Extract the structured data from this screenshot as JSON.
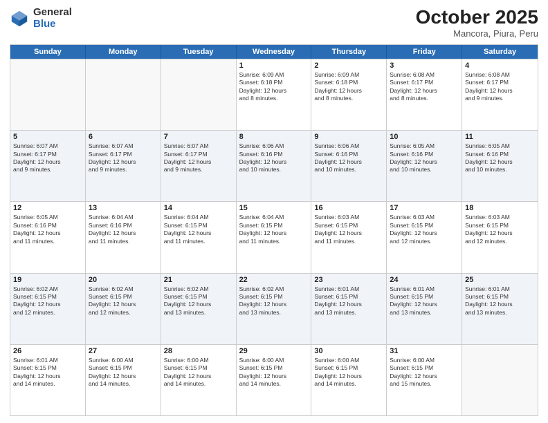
{
  "logo": {
    "general": "General",
    "blue": "Blue"
  },
  "header": {
    "month": "October 2025",
    "location": "Mancora, Piura, Peru"
  },
  "weekdays": [
    "Sunday",
    "Monday",
    "Tuesday",
    "Wednesday",
    "Thursday",
    "Friday",
    "Saturday"
  ],
  "rows": [
    {
      "alt": false,
      "cells": [
        {
          "day": "",
          "lines": []
        },
        {
          "day": "",
          "lines": []
        },
        {
          "day": "",
          "lines": []
        },
        {
          "day": "1",
          "lines": [
            "Sunrise: 6:09 AM",
            "Sunset: 6:18 PM",
            "Daylight: 12 hours",
            "and 8 minutes."
          ]
        },
        {
          "day": "2",
          "lines": [
            "Sunrise: 6:09 AM",
            "Sunset: 6:18 PM",
            "Daylight: 12 hours",
            "and 8 minutes."
          ]
        },
        {
          "day": "3",
          "lines": [
            "Sunrise: 6:08 AM",
            "Sunset: 6:17 PM",
            "Daylight: 12 hours",
            "and 8 minutes."
          ]
        },
        {
          "day": "4",
          "lines": [
            "Sunrise: 6:08 AM",
            "Sunset: 6:17 PM",
            "Daylight: 12 hours",
            "and 9 minutes."
          ]
        }
      ]
    },
    {
      "alt": true,
      "cells": [
        {
          "day": "5",
          "lines": [
            "Sunrise: 6:07 AM",
            "Sunset: 6:17 PM",
            "Daylight: 12 hours",
            "and 9 minutes."
          ]
        },
        {
          "day": "6",
          "lines": [
            "Sunrise: 6:07 AM",
            "Sunset: 6:17 PM",
            "Daylight: 12 hours",
            "and 9 minutes."
          ]
        },
        {
          "day": "7",
          "lines": [
            "Sunrise: 6:07 AM",
            "Sunset: 6:17 PM",
            "Daylight: 12 hours",
            "and 9 minutes."
          ]
        },
        {
          "day": "8",
          "lines": [
            "Sunrise: 6:06 AM",
            "Sunset: 6:16 PM",
            "Daylight: 12 hours",
            "and 10 minutes."
          ]
        },
        {
          "day": "9",
          "lines": [
            "Sunrise: 6:06 AM",
            "Sunset: 6:16 PM",
            "Daylight: 12 hours",
            "and 10 minutes."
          ]
        },
        {
          "day": "10",
          "lines": [
            "Sunrise: 6:05 AM",
            "Sunset: 6:16 PM",
            "Daylight: 12 hours",
            "and 10 minutes."
          ]
        },
        {
          "day": "11",
          "lines": [
            "Sunrise: 6:05 AM",
            "Sunset: 6:16 PM",
            "Daylight: 12 hours",
            "and 10 minutes."
          ]
        }
      ]
    },
    {
      "alt": false,
      "cells": [
        {
          "day": "12",
          "lines": [
            "Sunrise: 6:05 AM",
            "Sunset: 6:16 PM",
            "Daylight: 12 hours",
            "and 11 minutes."
          ]
        },
        {
          "day": "13",
          "lines": [
            "Sunrise: 6:04 AM",
            "Sunset: 6:16 PM",
            "Daylight: 12 hours",
            "and 11 minutes."
          ]
        },
        {
          "day": "14",
          "lines": [
            "Sunrise: 6:04 AM",
            "Sunset: 6:15 PM",
            "Daylight: 12 hours",
            "and 11 minutes."
          ]
        },
        {
          "day": "15",
          "lines": [
            "Sunrise: 6:04 AM",
            "Sunset: 6:15 PM",
            "Daylight: 12 hours",
            "and 11 minutes."
          ]
        },
        {
          "day": "16",
          "lines": [
            "Sunrise: 6:03 AM",
            "Sunset: 6:15 PM",
            "Daylight: 12 hours",
            "and 11 minutes."
          ]
        },
        {
          "day": "17",
          "lines": [
            "Sunrise: 6:03 AM",
            "Sunset: 6:15 PM",
            "Daylight: 12 hours",
            "and 12 minutes."
          ]
        },
        {
          "day": "18",
          "lines": [
            "Sunrise: 6:03 AM",
            "Sunset: 6:15 PM",
            "Daylight: 12 hours",
            "and 12 minutes."
          ]
        }
      ]
    },
    {
      "alt": true,
      "cells": [
        {
          "day": "19",
          "lines": [
            "Sunrise: 6:02 AM",
            "Sunset: 6:15 PM",
            "Daylight: 12 hours",
            "and 12 minutes."
          ]
        },
        {
          "day": "20",
          "lines": [
            "Sunrise: 6:02 AM",
            "Sunset: 6:15 PM",
            "Daylight: 12 hours",
            "and 12 minutes."
          ]
        },
        {
          "day": "21",
          "lines": [
            "Sunrise: 6:02 AM",
            "Sunset: 6:15 PM",
            "Daylight: 12 hours",
            "and 13 minutes."
          ]
        },
        {
          "day": "22",
          "lines": [
            "Sunrise: 6:02 AM",
            "Sunset: 6:15 PM",
            "Daylight: 12 hours",
            "and 13 minutes."
          ]
        },
        {
          "day": "23",
          "lines": [
            "Sunrise: 6:01 AM",
            "Sunset: 6:15 PM",
            "Daylight: 12 hours",
            "and 13 minutes."
          ]
        },
        {
          "day": "24",
          "lines": [
            "Sunrise: 6:01 AM",
            "Sunset: 6:15 PM",
            "Daylight: 12 hours",
            "and 13 minutes."
          ]
        },
        {
          "day": "25",
          "lines": [
            "Sunrise: 6:01 AM",
            "Sunset: 6:15 PM",
            "Daylight: 12 hours",
            "and 13 minutes."
          ]
        }
      ]
    },
    {
      "alt": false,
      "cells": [
        {
          "day": "26",
          "lines": [
            "Sunrise: 6:01 AM",
            "Sunset: 6:15 PM",
            "Daylight: 12 hours",
            "and 14 minutes."
          ]
        },
        {
          "day": "27",
          "lines": [
            "Sunrise: 6:00 AM",
            "Sunset: 6:15 PM",
            "Daylight: 12 hours",
            "and 14 minutes."
          ]
        },
        {
          "day": "28",
          "lines": [
            "Sunrise: 6:00 AM",
            "Sunset: 6:15 PM",
            "Daylight: 12 hours",
            "and 14 minutes."
          ]
        },
        {
          "day": "29",
          "lines": [
            "Sunrise: 6:00 AM",
            "Sunset: 6:15 PM",
            "Daylight: 12 hours",
            "and 14 minutes."
          ]
        },
        {
          "day": "30",
          "lines": [
            "Sunrise: 6:00 AM",
            "Sunset: 6:15 PM",
            "Daylight: 12 hours",
            "and 14 minutes."
          ]
        },
        {
          "day": "31",
          "lines": [
            "Sunrise: 6:00 AM",
            "Sunset: 6:15 PM",
            "Daylight: 12 hours",
            "and 15 minutes."
          ]
        },
        {
          "day": "",
          "lines": []
        }
      ]
    }
  ]
}
